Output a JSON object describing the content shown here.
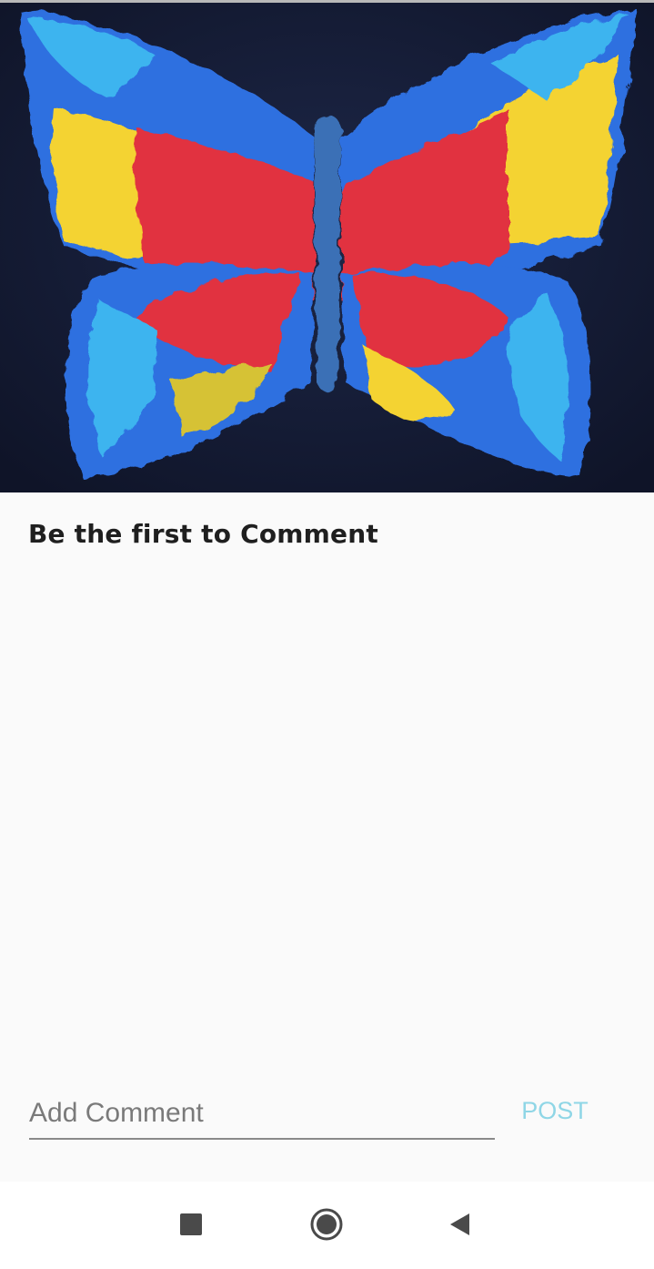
{
  "artwork": {
    "icon": "butterfly-painting",
    "colors": {
      "background": "#141b33",
      "wing_yellow": "#f4d330",
      "wing_red": "#e1303f",
      "wing_blue": "#2f6fe0",
      "wing_cyan": "#3cb4ef",
      "body": "#3a6fb6"
    }
  },
  "comments": {
    "empty_message": "Be the first to Comment"
  },
  "composer": {
    "placeholder": "Add Comment",
    "value": "",
    "post_label": "POST",
    "accent_color": "#8fd6e6"
  },
  "nav": {
    "recents_icon": "square-icon",
    "home_icon": "circle-icon",
    "back_icon": "triangle-back-icon"
  }
}
